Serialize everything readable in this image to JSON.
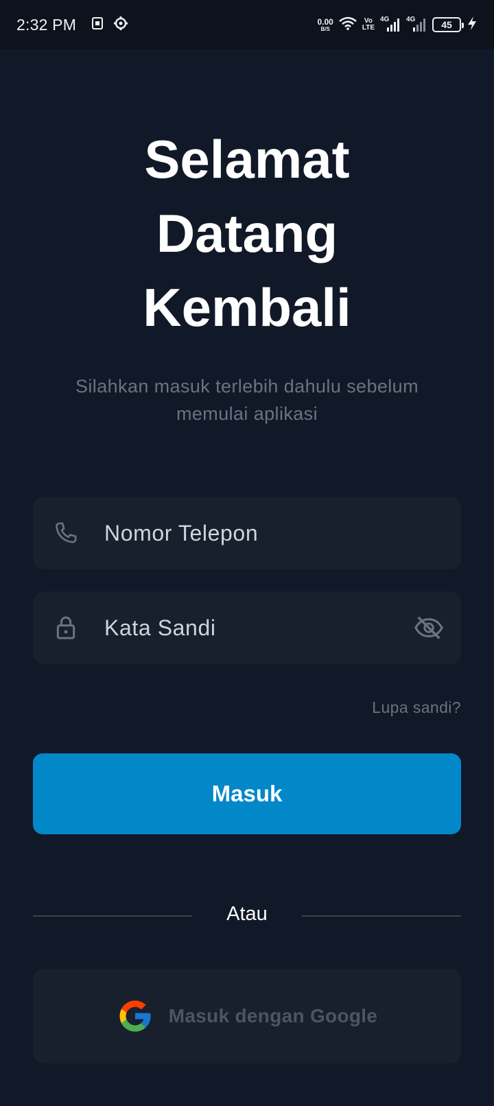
{
  "status_bar": {
    "time": "2:32 PM",
    "net_speed_value": "0.00",
    "net_speed_unit": "B/S",
    "volte_top": "Vo",
    "volte_bottom": "LTE",
    "sim1_label": "4G",
    "sim2_label": "4G",
    "battery": "45",
    "icons": [
      "sim-card-icon",
      "settings-gear-icon",
      "wifi-icon",
      "signal-icon",
      "signal-icon",
      "battery-icon",
      "charging-bolt-icon"
    ]
  },
  "login": {
    "title_line1": "Selamat",
    "title_line2": "Datang",
    "title_line3": "Kembali",
    "subtitle_line1": "Silahkan masuk terlebih dahulu sebelum",
    "subtitle_line2": "memulai aplikasi",
    "phone_placeholder": "Nomor Telepon",
    "password_placeholder": "Kata Sandi",
    "forgot_password": "Lupa sandi?",
    "login_button": "Masuk",
    "or_text": "Atau",
    "google_button": "Masuk dengan Google"
  },
  "colors": {
    "background": "#111827",
    "input_background": "#18202d",
    "primary": "#0287c9",
    "muted_text": "#6b7280"
  }
}
